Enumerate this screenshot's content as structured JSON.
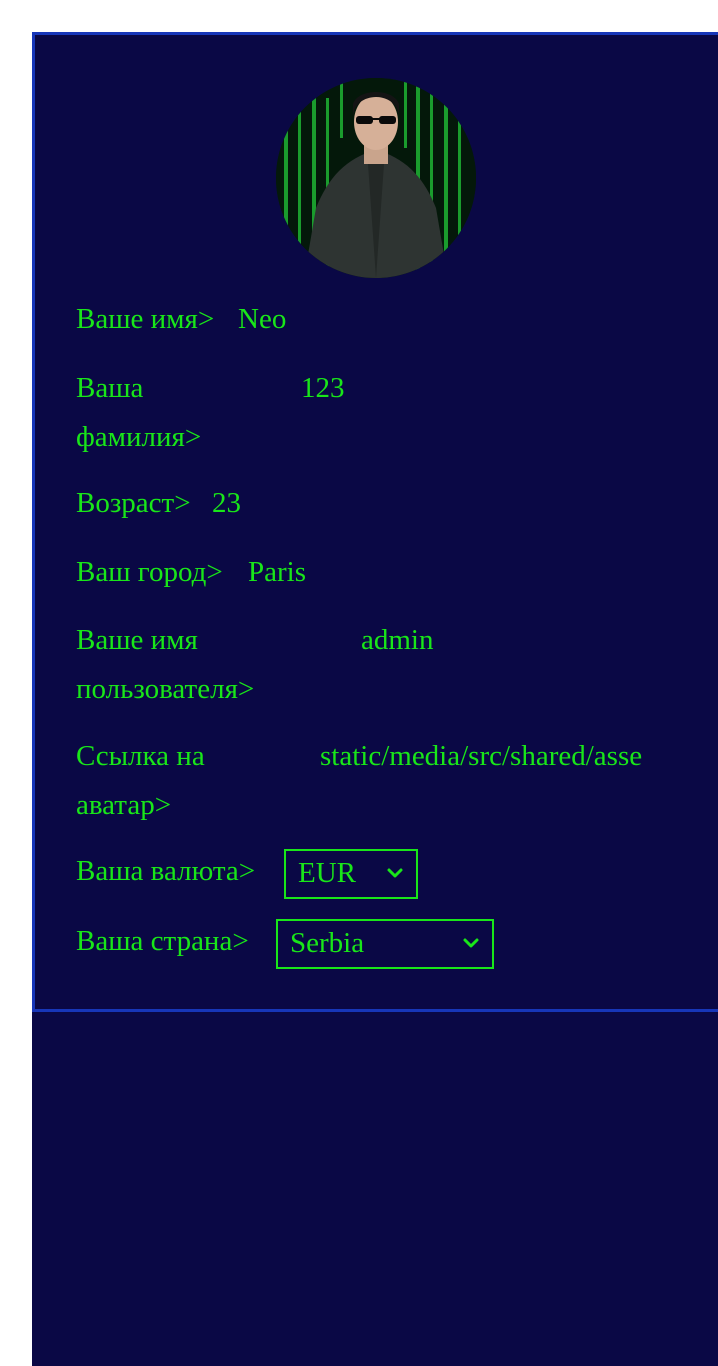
{
  "profile": {
    "fields": [
      {
        "label": "Ваше имя>",
        "value": "Neo"
      },
      {
        "label": "Ваша фамилия>",
        "value": "123"
      },
      {
        "label": "Возраст>",
        "value": "23"
      },
      {
        "label": "Ваш город>",
        "value": "Paris"
      },
      {
        "label": "Ваше имя пользователя>",
        "value": "admin"
      },
      {
        "label": "Ссылка на аватар>",
        "value": "static/media/src/shared/asse"
      }
    ],
    "currency": {
      "label": "Ваша валюта>",
      "selected": "EUR"
    },
    "country": {
      "label": "Ваша страна>",
      "selected": "Serbia"
    }
  },
  "colors": {
    "background": "#0a0845",
    "border": "#1736b8",
    "text": "#19e619"
  },
  "icons": {
    "select_arrow": "chevron-down-icon",
    "avatar": "user-avatar-image"
  }
}
